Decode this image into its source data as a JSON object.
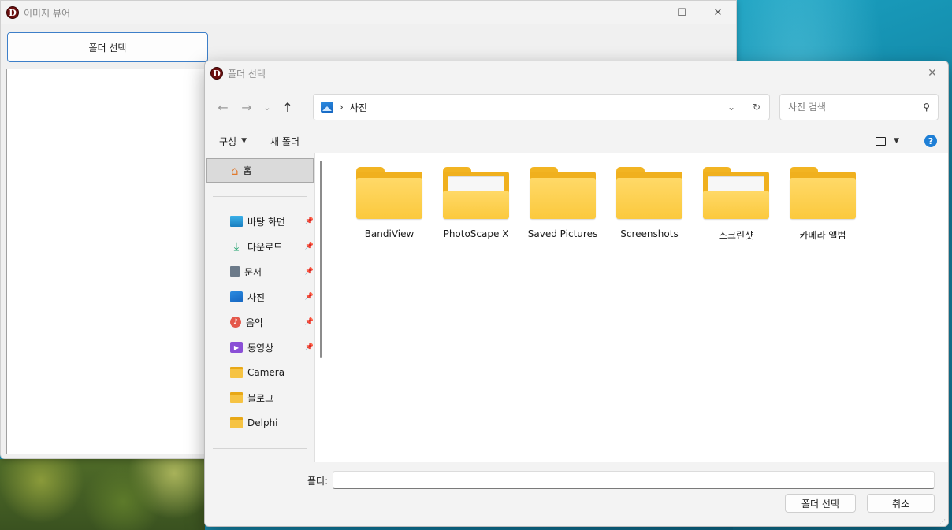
{
  "app": {
    "logo_letter": "D",
    "title": "이미지 뷰어",
    "select_folder_label": "폴더 선택",
    "controls": {
      "minimize": "—",
      "maximize": "☐",
      "close": "✕"
    }
  },
  "dialog": {
    "title": "폴더 선택",
    "close": "✕",
    "nav": {
      "back": "←",
      "forward": "→",
      "recent": "⌄",
      "up": "↑"
    },
    "address": {
      "separator": "›",
      "path": "사진",
      "dropdown": "⌄",
      "refresh": "↻"
    },
    "search": {
      "placeholder": "사진 검색",
      "value": "",
      "icon": "⚲"
    },
    "toolbar": {
      "organize_label": "구성",
      "organize_caret": "▼",
      "new_folder_label": "새 폴더",
      "view_caret": "▼",
      "help_glyph": "?"
    },
    "nav_pane": {
      "home_label": "홈",
      "items": [
        {
          "label": "바탕 화면",
          "icon": "desktop-icon",
          "pinned": true
        },
        {
          "label": "다운로드",
          "icon": "download-icon",
          "pinned": true
        },
        {
          "label": "문서",
          "icon": "documents-icon",
          "pinned": true
        },
        {
          "label": "사진",
          "icon": "pictures-icon",
          "pinned": true
        },
        {
          "label": "음악",
          "icon": "music-icon",
          "pinned": true
        },
        {
          "label": "동영상",
          "icon": "videos-icon",
          "pinned": true
        },
        {
          "label": "Camera",
          "icon": "folder-icon",
          "pinned": false
        },
        {
          "label": "블로그",
          "icon": "folder-icon",
          "pinned": false
        },
        {
          "label": "Delphi",
          "icon": "folder-icon",
          "pinned": false
        }
      ]
    },
    "folders": [
      {
        "name": "BandiView",
        "has_content": false
      },
      {
        "name": "PhotoScape X",
        "has_content": true
      },
      {
        "name": "Saved Pictures",
        "has_content": false
      },
      {
        "name": "Screenshots",
        "has_content": false
      },
      {
        "name": "스크린샷",
        "has_content": true
      },
      {
        "name": "카메라 앨범",
        "has_content": false
      }
    ],
    "footer": {
      "folder_label": "폴더:",
      "folder_value": "",
      "select_button": "폴더 선택",
      "cancel_button": "취소"
    }
  },
  "colors": {
    "accent": "#3d7fc9",
    "folder": "#fbc93d",
    "help": "#1e7fd6",
    "logo": "#6b0f0f"
  }
}
